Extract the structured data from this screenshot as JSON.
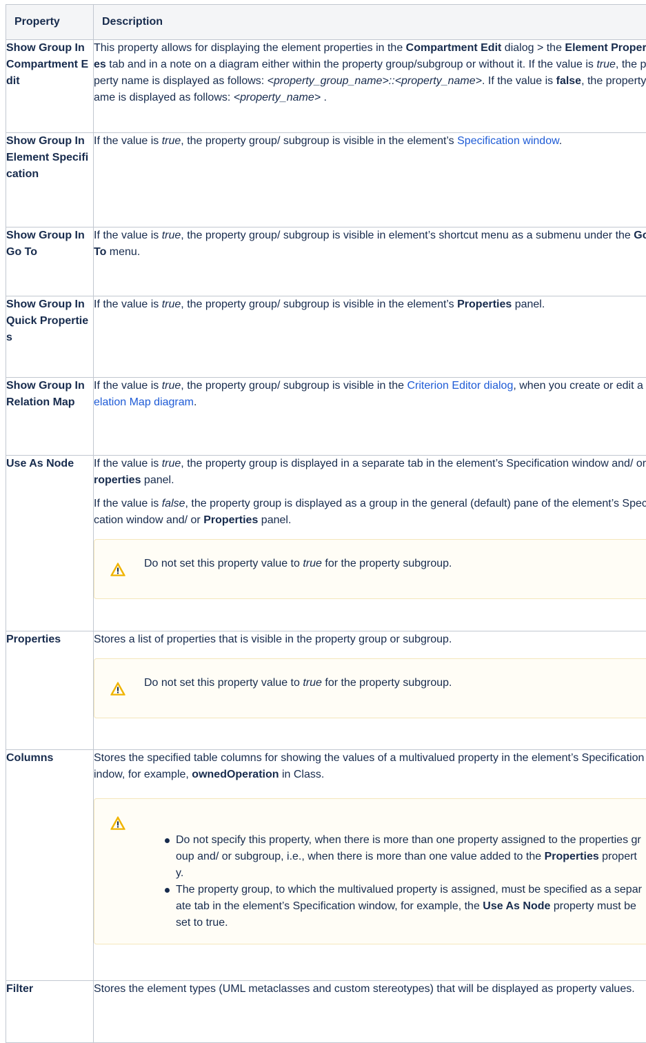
{
  "headers": {
    "property": "Property",
    "description": "Description"
  },
  "rows": {
    "r0": {
      "name": "Show Group In Compartment Edit",
      "a": "This property allows for displaying the element properties in the ",
      "b": "Compartment Edit",
      "c": " dialog > the ",
      "d": "Element Properties",
      "e": " tab and in a note on a diagram either within the property group/subgroup or without it. If the value is ",
      "f": "true",
      "g": ", the property name is displayed as follows: ",
      "h": "<property_group_name>::<property_name>",
      "i": ". If the value is ",
      "j": "false",
      "k": ", the property name is displayed as follows: ",
      "l": "<property_name>",
      "m": " ."
    },
    "r1": {
      "name": "Show Group In Element Specification",
      "a": "If the value is ",
      "b": "true",
      "c": ", the property group/ subgroup is visible in the element’s ",
      "link": "Specification window",
      "d": "."
    },
    "r2": {
      "name": "Show Group In Go To",
      "a": "If the value is ",
      "b": "true",
      "c": ", the property group/ subgroup is visible in element’s shortcut menu as a submenu under the ",
      "d": "Go To",
      "e": " menu."
    },
    "r3": {
      "name": "Show Group In Quick Properties",
      "a": "If the value is ",
      "b": "true",
      "c": ", the property group/ subgroup is visible in the element’s ",
      "d": "Properties",
      "e": " panel."
    },
    "r4": {
      "name": "Show Group In Relation Map",
      "a": "If the value is ",
      "b": "true",
      "c": ", the property group/ subgroup is visible in the ",
      "link1": "Criterion Editor dialog",
      "d": ", when you create or edit a ",
      "link2": "Relation Map diagram",
      "e": "."
    },
    "r5": {
      "name": "Use As Node",
      "p1a": "If the value is ",
      "p1b": "true",
      "p1c": ", the property group is displayed in a separate tab in the element’s Specification window and/ or ",
      "p1d": "Properties",
      "p1e": " panel.",
      "p2a": "If the value is ",
      "p2b": "false",
      "p2c": ", the property group is displayed as a group in the general (default) pane of the element’s Specification window and/ or ",
      "p2d": "Properties",
      "p2e": " panel.",
      "note_a": "Do not set this property value to ",
      "note_b": "true",
      "note_c": " for the property subgroup."
    },
    "r6": {
      "name": "Properties",
      "text": "Stores a list of properties that is visible in the property group or subgroup.",
      "note_a": "Do not set this property value to ",
      "note_b": "true",
      "note_c": " for the property subgroup."
    },
    "r7": {
      "name": "Columns",
      "a": "Stores the specified table columns for showing the values of a multivalued property in the element’s Specification window, for example, ",
      "b": "ownedOperation",
      "c": " in Class.",
      "li1a": "Do not specify this property, when there is more than one property assigned to the properties group and/ or subgroup, i.e., when there is more than one value added to the ",
      "li1b": "Properties",
      "li1c": " property.",
      "li2a": "The property group, to which the multivalued property is assigned, must be specified as a separate tab in the element’s Specification window, for example, the ",
      "li2b": "Use As Node",
      "li2c": " property must be set to true."
    },
    "r8": {
      "name": "Filter",
      "text": "Stores the element types (UML metaclasses and custom stereotypes) that will be displayed as property values."
    }
  },
  "icons": {
    "warning": "warning-icon"
  },
  "colors": {
    "link": "#1e5bd6",
    "header_bg": "#f4f5f7",
    "note_bg": "#fffdf6",
    "warning": "#f0b400"
  }
}
